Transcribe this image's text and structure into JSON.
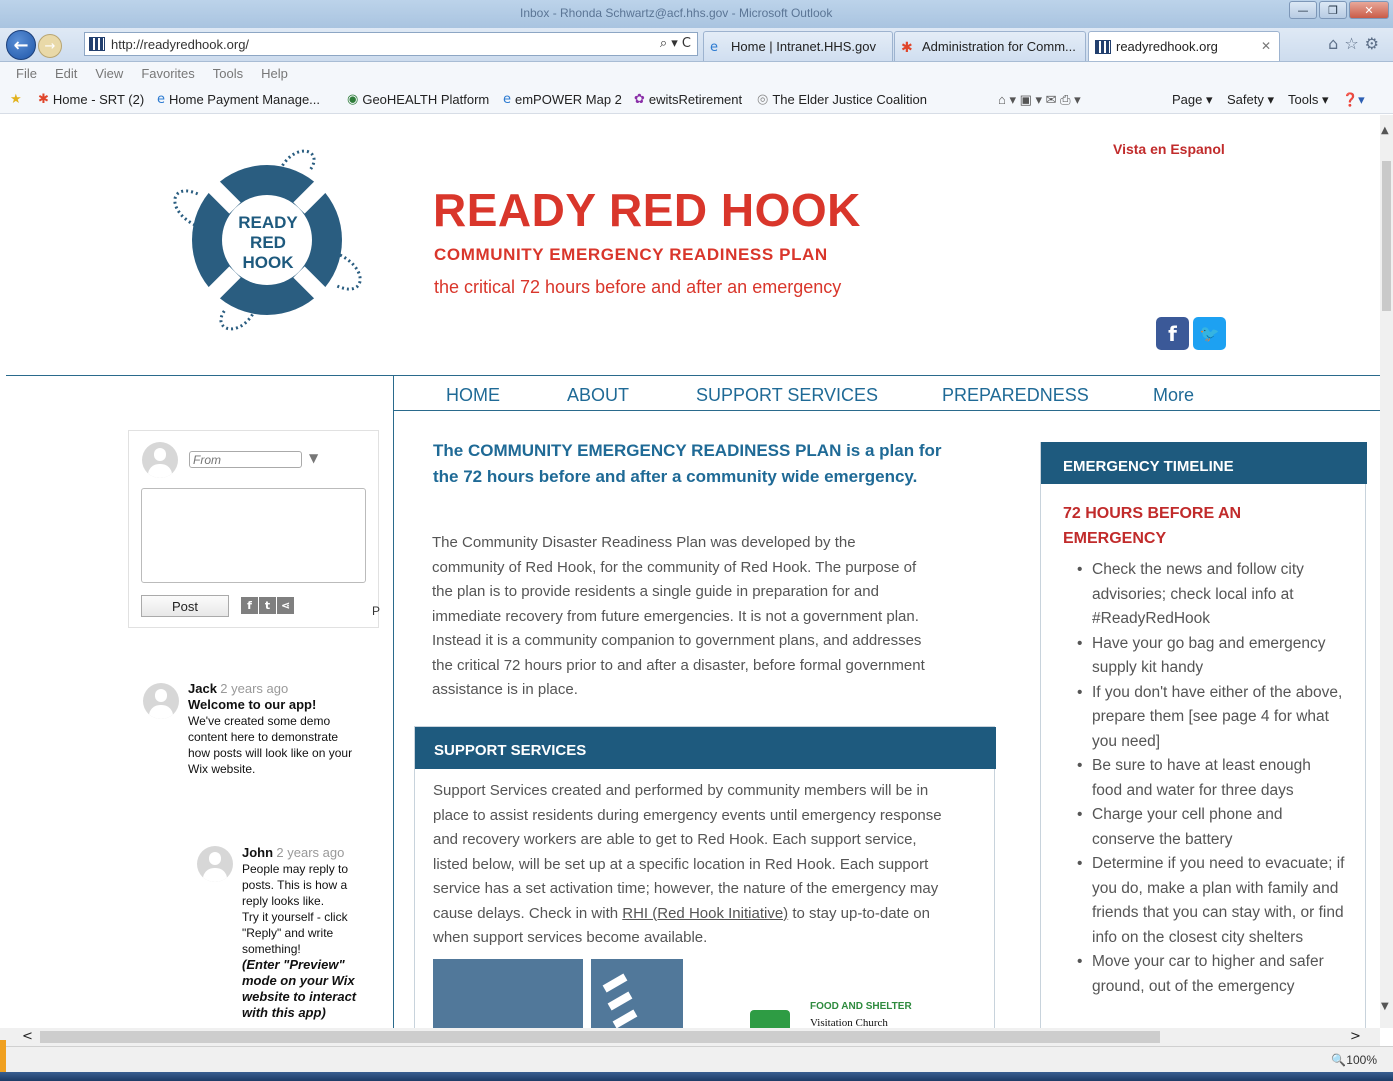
{
  "browser": {
    "window_title": "Inbox - Rhonda Schwartz@acf.hhs.gov - Microsoft Outlook",
    "address": "http://readyredhook.org/",
    "address_tools": "⌕ ▾ C",
    "tabs": [
      {
        "label": "Home | Intranet.HHS.gov"
      },
      {
        "label": "Administration for Comm..."
      },
      {
        "label": "readyredhook.org"
      }
    ],
    "menu": [
      "File",
      "Edit",
      "View",
      "Favorites",
      "Tools",
      "Help"
    ],
    "favorites": [
      {
        "label": "Home - SRT (2)"
      },
      {
        "label": "Home  Payment Manage..."
      },
      {
        "label": "GeoHEALTH Platform"
      },
      {
        "label": "emPOWER Map 2"
      },
      {
        "label": "ewitsRetirement"
      },
      {
        "label": "The Elder Justice Coalition"
      }
    ],
    "commands": {
      "page": "Page ▾",
      "safety": "Safety ▾",
      "tools": "Tools ▾"
    },
    "zoom": "🔍100%"
  },
  "site": {
    "logo_text": "READY RED HOOK",
    "title": "READY RED HOOK",
    "subtitle": "COMMUNITY EMERGENCY READINESS PLAN",
    "tagline": "the critical 72 hours before and after an emergency",
    "lang_link": "Vista en Espanol",
    "nav": [
      "HOME",
      "ABOUT",
      "SUPPORT SERVICES",
      "PREPAREDNESS",
      "More"
    ]
  },
  "comments": {
    "from_placeholder": "From",
    "post_label": "Post",
    "trailing_letter": "P",
    "posts": [
      {
        "author": "Jack",
        "ago": "2 years ago",
        "title": "Welcome to our app!",
        "body": [
          "We've created some demo",
          "content here to demonstrate",
          "how posts will look like on your",
          "Wix website."
        ]
      },
      {
        "author": "John",
        "ago": "2 years ago",
        "body": [
          "People may reply to",
          "posts. This is how a",
          "reply looks like.",
          "Try it yourself - click",
          "\"Reply\" and write",
          "something!"
        ],
        "emphasis": [
          "(Enter \"Preview\"",
          "mode on your Wix",
          "website to interact",
          "with this app)"
        ]
      }
    ]
  },
  "main": {
    "intro_heading": "The COMMUNITY EMERGENCY READINESS PLAN is a plan for the 72 hours before and after a community wide emergency.",
    "intro_body": "The Community Disaster Readiness Plan was developed by the community of Red Hook, for the community of Red Hook. The purpose of the plan is to provide residents a single guide in preparation for and immediate recovery from future emergencies.  It is not a government plan. Instead it is a community companion to government plans, and addresses the critical 72 hours prior to and after a disaster, before formal government assistance is in place.",
    "support": {
      "heading": "SUPPORT SERVICES",
      "body_before": "Support Services created and performed by community members will be in place to assist residents during emergency events until emergency response and recovery workers are able to get to Red Hook. Each support service, listed below, will be set up at a specific location in Red Hook. Each support service has a set activation time; however, the nature of the emergency may cause delays. Check in with ",
      "link": "RHI (Red Hook Initiative)",
      "body_after": " to stay up-to-date on when support services become available.",
      "map_label": "FOOD AND SHELTER",
      "map_place": "Visitation Church"
    }
  },
  "timeline": {
    "heading": "EMERGENCY TIMELINE",
    "subheading": "72 HOURS BEFORE AN EMERGENCY",
    "items": [
      "Check the news and follow city advisories; check local info at #ReadyRedHook",
      "Have your go bag and emergency supply kit handy",
      "If you don't have either of the above, prepare them [see page 4 for what you need]",
      "Be sure to have at least enough food and water for three days",
      "Charge your cell phone and conserve the battery",
      "Determine if you need to evacuate; if you do, make a plan with family and friends that you can stay with, or find info on the closest city shelters",
      "Move your car to higher and safer ground, out of the emergency"
    ]
  },
  "colors": {
    "brand_red": "#d9362b",
    "brand_blue": "#1e5a7e",
    "nav_blue": "#1f6a96"
  }
}
